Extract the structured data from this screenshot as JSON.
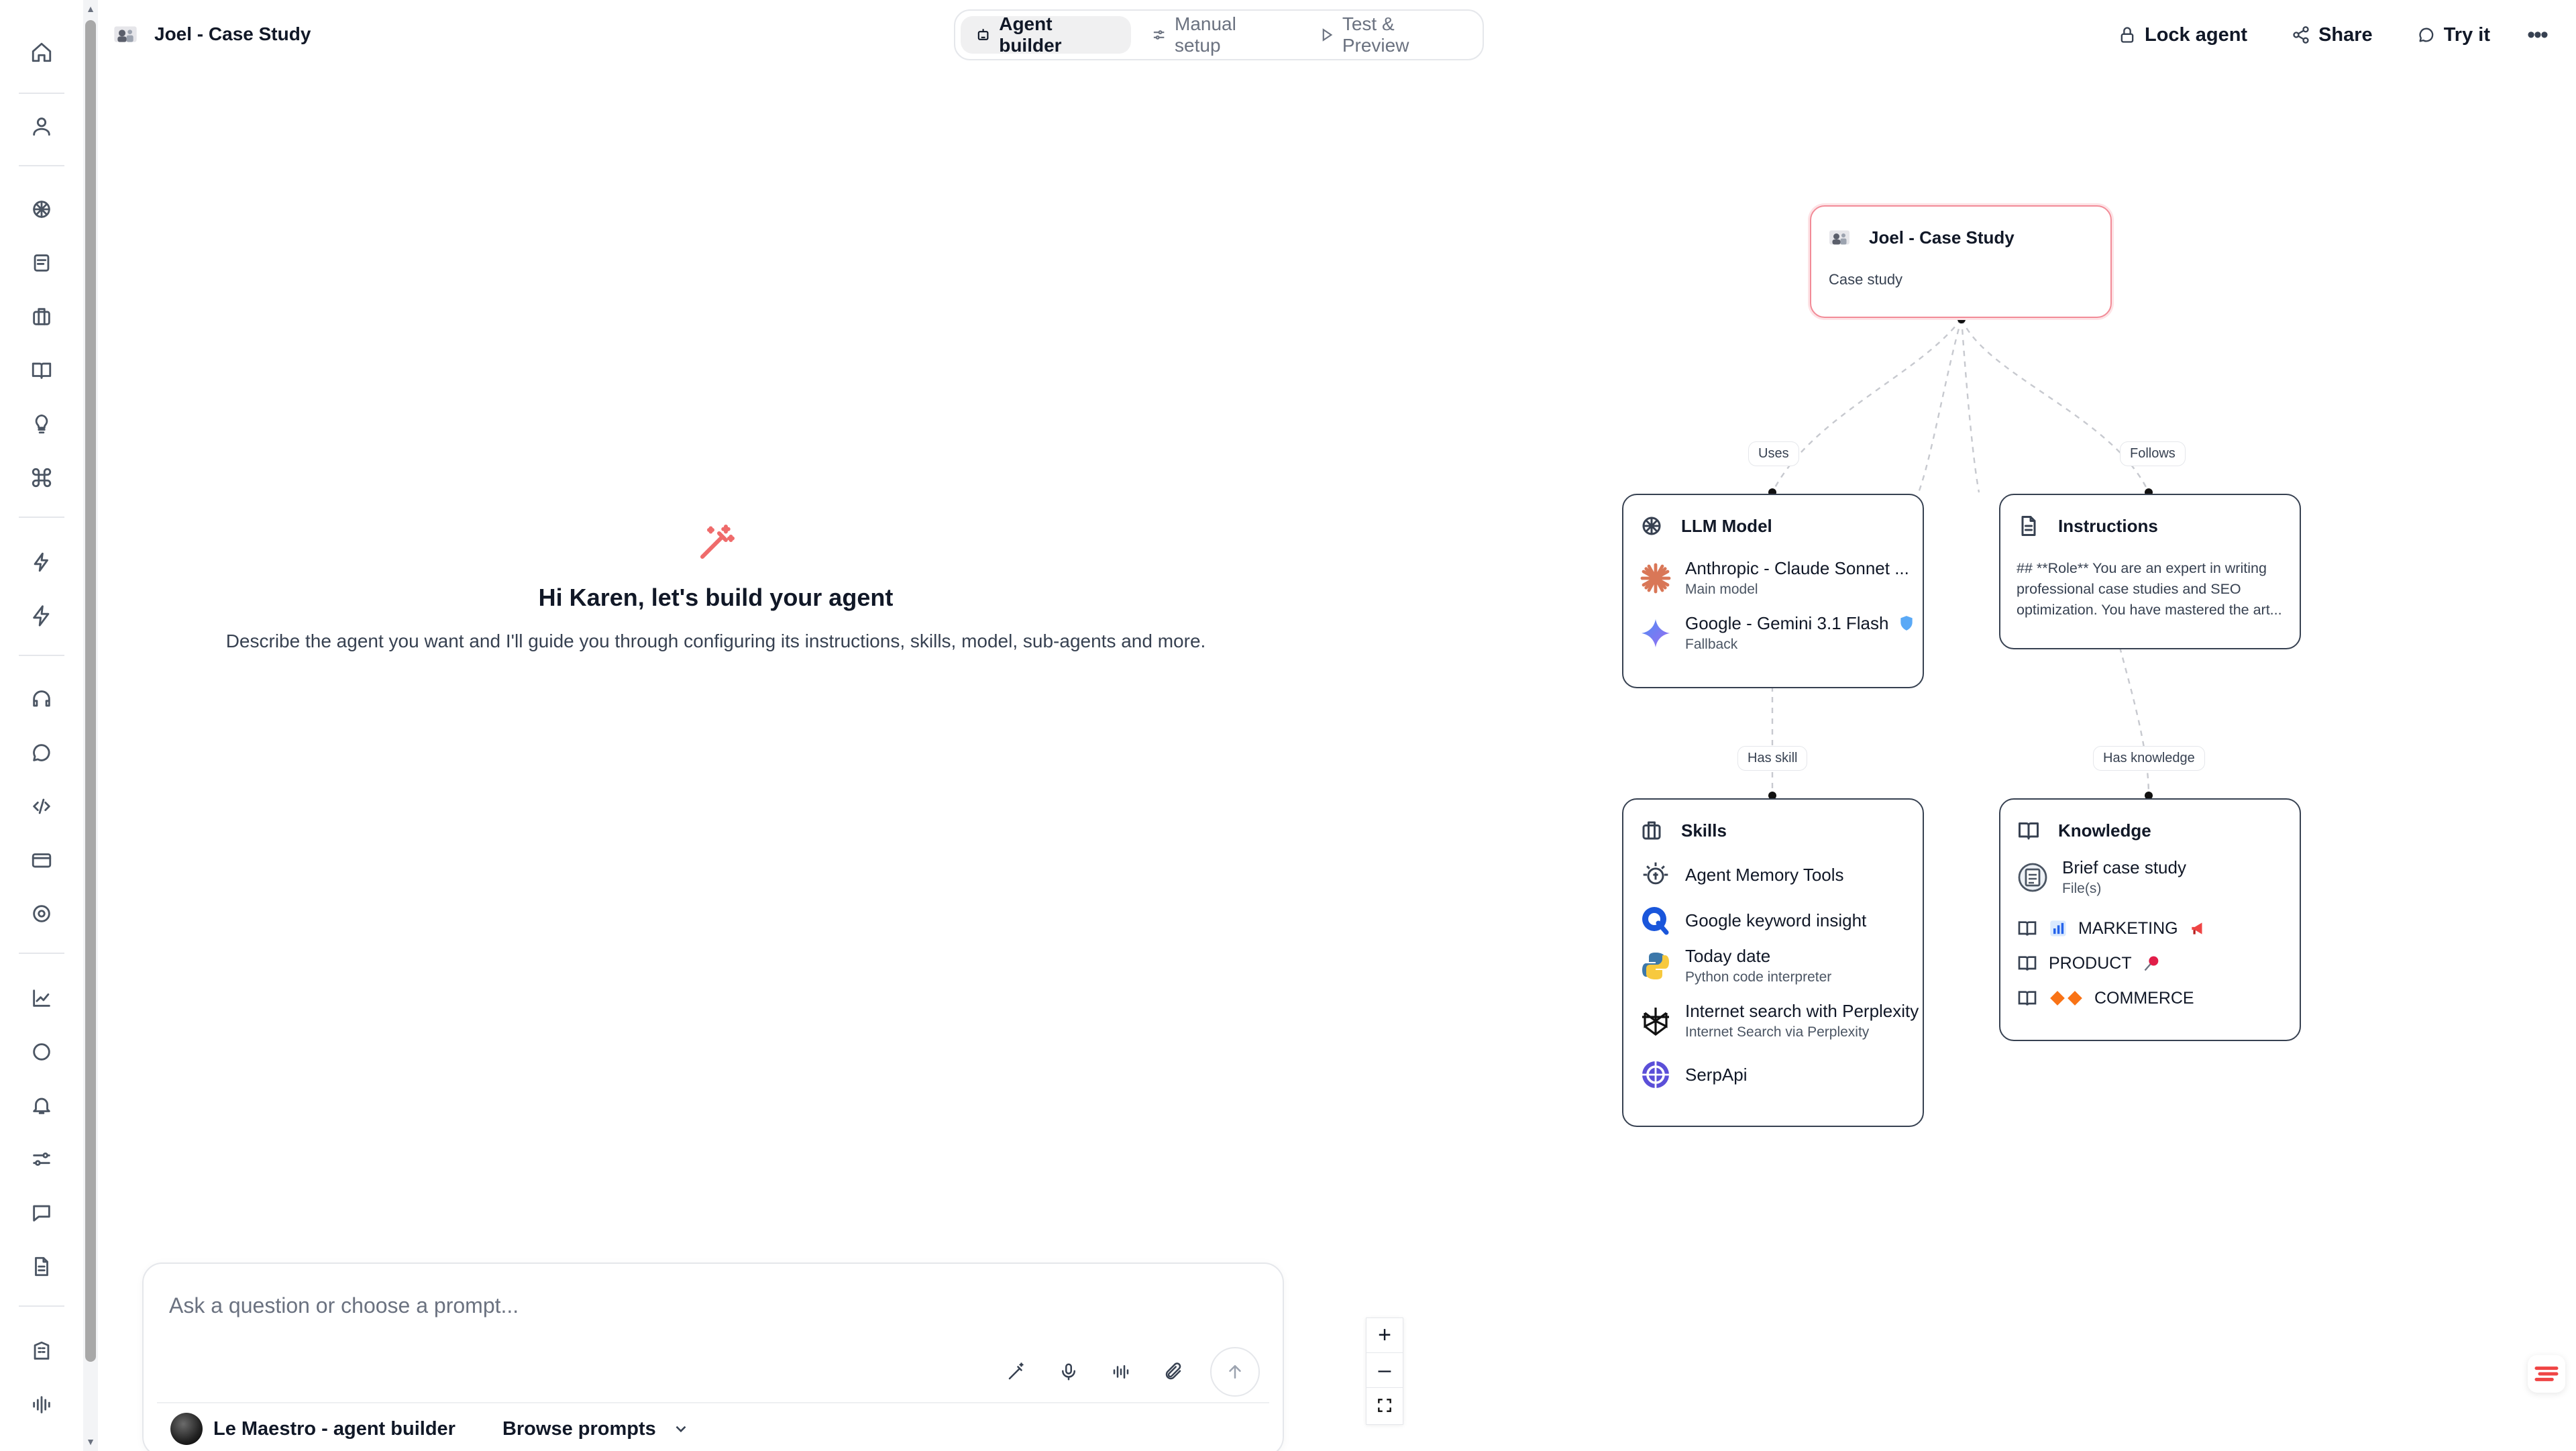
{
  "header": {
    "agent_title": "Joel - Case Study",
    "tabs": [
      {
        "label": "Agent builder",
        "icon": "robot-icon",
        "active": true
      },
      {
        "label": "Manual setup",
        "icon": "sliders-icon",
        "active": false
      },
      {
        "label": "Test & Preview",
        "icon": "play-icon",
        "active": false
      }
    ],
    "actions": {
      "lock": "Lock agent",
      "share": "Share",
      "try": "Try it"
    }
  },
  "sidebar": {
    "icons": [
      "home-icon",
      "user-icon",
      "brain-icon",
      "notes-icon",
      "briefcase-icon",
      "book-icon",
      "lightbulb-icon",
      "command-icon",
      "sparkle-bolt-icon",
      "bolt-icon",
      "headset-icon",
      "chat-bubble-icon",
      "code-icon",
      "card-icon",
      "help-circle-icon",
      "chart-icon",
      "message-icon",
      "bell-icon",
      "settings-sliders-icon",
      "comment-icon",
      "document-icon",
      "building-icon",
      "audio-icon"
    ]
  },
  "welcome": {
    "title": "Hi Karen, let's build your agent",
    "subtitle": "Describe the agent you want and I'll guide you through configuring its instructions, skills, model, sub-agents and more."
  },
  "prompt": {
    "placeholder": "Ask a question or choose a prompt...",
    "builder": "Le Maestro - agent builder",
    "browse": "Browse prompts"
  },
  "graph": {
    "root": {
      "title": "Joel - Case Study",
      "subtitle": "Case study"
    },
    "edges": {
      "uses": "Uses",
      "follows": "Follows",
      "has_skill": "Has skill",
      "has_knowledge": "Has knowledge"
    },
    "llm": {
      "title": "LLM Model",
      "models": [
        {
          "name": "Anthropic - Claude Sonnet ...",
          "role": "Main model"
        },
        {
          "name": "Google - Gemini 3.1 Flash",
          "role": "Fallback"
        }
      ]
    },
    "instructions": {
      "title": "Instructions",
      "text": "## **Role** You are an expert in writing professional case studies and SEO optimization. You have mastered the art..."
    },
    "skills": {
      "title": "Skills",
      "items": [
        {
          "name": "Agent Memory Tools",
          "sub": ""
        },
        {
          "name": "Google keyword insight",
          "sub": ""
        },
        {
          "name": "Today date",
          "sub": "Python code interpreter"
        },
        {
          "name": "Internet search with Perplexity",
          "sub": "Internet Search via Perplexity"
        },
        {
          "name": "SerpApi",
          "sub": ""
        }
      ]
    },
    "knowledge": {
      "title": "Knowledge",
      "file": {
        "name": "Brief case study",
        "sub": "File(s)"
      },
      "items": [
        "MARKETING",
        "PRODUCT",
        "COMMERCE"
      ]
    }
  },
  "colors": {
    "root_border": "#f28b97",
    "accent": "#ef6b6b",
    "node_border": "#374151"
  }
}
